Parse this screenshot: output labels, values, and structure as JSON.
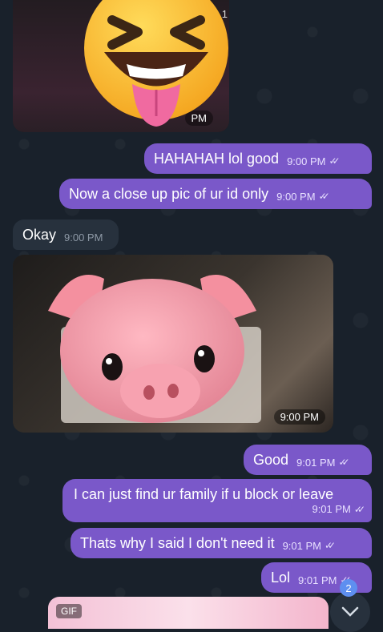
{
  "theme": {
    "outgoing_bubble": "#7a58c9",
    "incoming_bubble": "#27313d",
    "background": "#19212b"
  },
  "messages": {
    "top_media": {
      "time_fragment": "PM",
      "counter_fragment": "1",
      "sticker": "grinning-squinting-tongue-emoji"
    },
    "m1": {
      "text": "HAHAHAH lol good",
      "time": "9:00 PM"
    },
    "m2": {
      "text": "Now a close up pic of ur id only",
      "time": "9:00 PM"
    },
    "m3": {
      "text": "Okay",
      "time": "9:00 PM"
    },
    "photo": {
      "time": "9:00 PM",
      "sticker": "pig-face-emoji"
    },
    "m4": {
      "text": "Good",
      "time": "9:01 PM"
    },
    "m5": {
      "text": "I can just find ur family if u block or leave",
      "time": "9:01 PM"
    },
    "m6": {
      "text": "Thats why I said I don't need it",
      "time": "9:01 PM"
    },
    "m7": {
      "text": "Lol",
      "time": "9:01 PM"
    }
  },
  "gif": {
    "label": "GIF"
  },
  "scroll": {
    "unread_count": "2",
    "icon": "chevron-down-icon"
  }
}
